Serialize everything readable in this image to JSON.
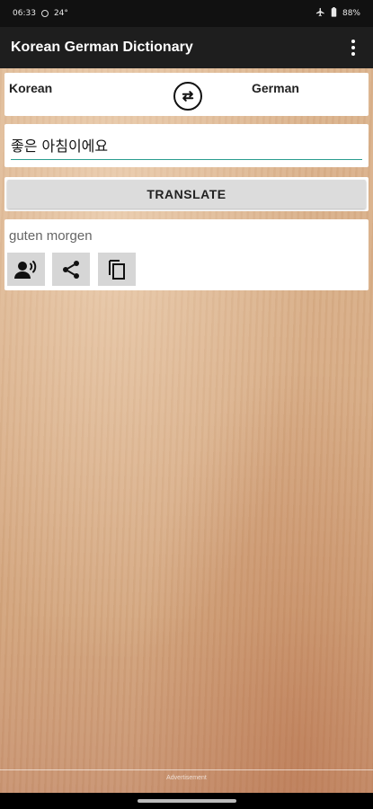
{
  "status_bar": {
    "time": "06:33",
    "temperature": "24°",
    "battery": "88%",
    "icons": [
      "status-dot-icon",
      "airplane-icon",
      "battery-icon"
    ]
  },
  "app_bar": {
    "title": "Korean German Dictionary",
    "menu_icon": "overflow-menu-icon"
  },
  "languages": {
    "source": "Korean",
    "target": "German",
    "swap_icon": "swap-icon"
  },
  "input": {
    "value": "좋은 아침이에요",
    "accent_color": "#2a9d8f"
  },
  "translate_button": {
    "label": "TRANSLATE"
  },
  "result": {
    "text": "guten morgen",
    "actions": [
      {
        "icon": "speak-icon"
      },
      {
        "icon": "share-icon"
      },
      {
        "icon": "copy-icon"
      }
    ]
  },
  "footer": {
    "ad_label": "Advertisement"
  }
}
